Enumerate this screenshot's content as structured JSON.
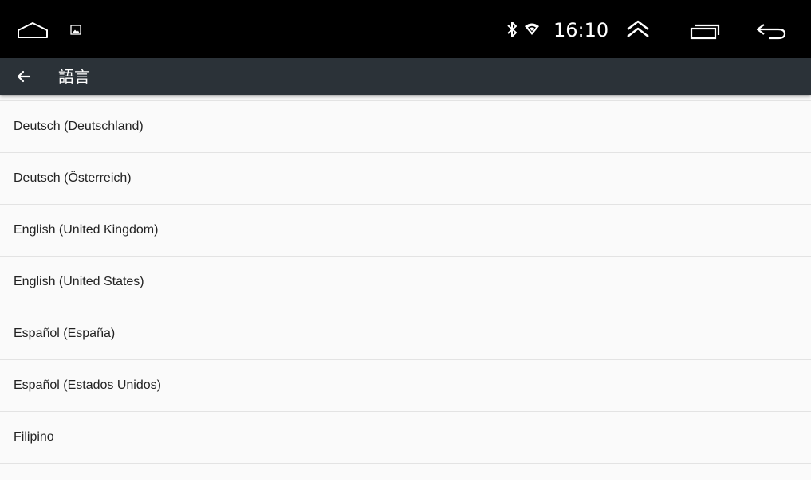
{
  "status_bar": {
    "time": "16:10",
    "icons": [
      "home-icon",
      "gallery-icon",
      "bluetooth-icon",
      "wifi-icon",
      "chevron-up-icon",
      "recents-icon",
      "back-icon"
    ],
    "background": "#000000"
  },
  "toolbar": {
    "title": "語言",
    "back_icon": "arrow-left-icon",
    "background": "#2b3238"
  },
  "languages": [
    {
      "label": "Deutsch (Deutschland)"
    },
    {
      "label": "Deutsch (Österreich)"
    },
    {
      "label": "English (United Kingdom)"
    },
    {
      "label": "English (United States)"
    },
    {
      "label": "Español (España)"
    },
    {
      "label": "Español (Estados Unidos)"
    },
    {
      "label": "Filipino"
    }
  ]
}
